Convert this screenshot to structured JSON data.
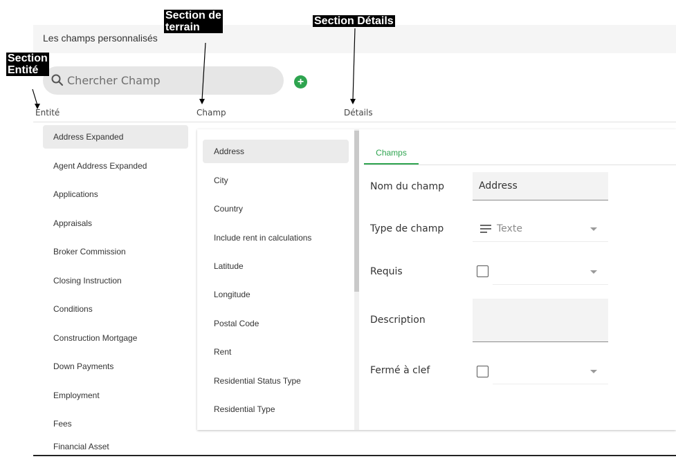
{
  "header": {
    "title": "Les champs personnalisés"
  },
  "search": {
    "placeholder": "Chercher Champ"
  },
  "columns": {
    "entity": "Entité",
    "field": "Champ",
    "details": "Détails"
  },
  "entities": [
    "Address Expanded",
    "Agent Address Expanded",
    "Applications",
    "Appraisals",
    "Broker Commission",
    "Closing Instruction",
    "Conditions",
    "Construction Mortgage",
    "Down Payments",
    "Employment",
    "Fees",
    "Financial Asset"
  ],
  "selected_entity": "Address Expanded",
  "fields": [
    "Address",
    "City",
    "Country",
    "Include rent in calculations",
    "Latitude",
    "Longitude",
    "Postal Code",
    "Rent",
    "Residential Status Type",
    "Residential Type"
  ],
  "selected_field": "Address",
  "details": {
    "tab": "Champs",
    "name_label": "Nom du champ",
    "name_value": "Address",
    "type_label": "Type de champ",
    "type_value": "Texte",
    "required_label": "Requis",
    "required_checked": false,
    "description_label": "Description",
    "description_value": "",
    "locked_label": "Fermé à clef",
    "locked_checked": false
  },
  "annotations": {
    "entity_section_line1": "Section",
    "entity_section_line2": "Entité",
    "field_section_line1": "Section de",
    "field_section_line2": "terrain",
    "details_section": "Section Détails"
  },
  "colors": {
    "accent": "#2ea44f",
    "selected_bg": "#ebebeb",
    "annotation_bg": "#000000"
  }
}
